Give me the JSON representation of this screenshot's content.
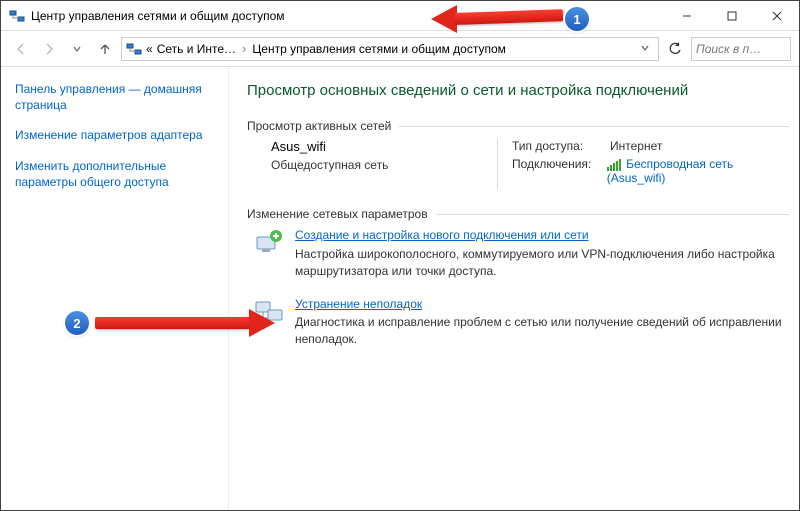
{
  "window": {
    "title": "Центр управления сетями и общим доступом"
  },
  "breadcrumb": {
    "part1": "Сеть и Инте…",
    "part2": "Центр управления сетями и общим доступом"
  },
  "search": {
    "placeholder": "Поиск в п…"
  },
  "sidebar": {
    "home": "Панель управления — домашняя страница",
    "adapter": "Изменение параметров адаптера",
    "sharing": "Изменить дополнительные параметры общего доступа"
  },
  "main": {
    "heading": "Просмотр основных сведений о сети и настройка подключений",
    "section_active": "Просмотр активных сетей",
    "section_change": "Изменение сетевых параметров",
    "network": {
      "name": "Asus_wifi",
      "type": "Общедоступная сеть",
      "access_label": "Тип доступа:",
      "access_value": "Интернет",
      "conn_label": "Подключения:",
      "conn_link": "Беспроводная сеть (Asus_wifi)"
    },
    "change1": {
      "link": "Создание и настройка нового подключения или сети",
      "desc": "Настройка широкополосного, коммутируемого или VPN-подключения либо настройка маршрутизатора или точки доступа."
    },
    "change2": {
      "link": "Устранение неполадок",
      "desc": "Диагностика и исправление проблем с сетью или получение сведений об исправлении неполадок."
    }
  },
  "annotations": {
    "badge1": "1",
    "badge2": "2"
  }
}
